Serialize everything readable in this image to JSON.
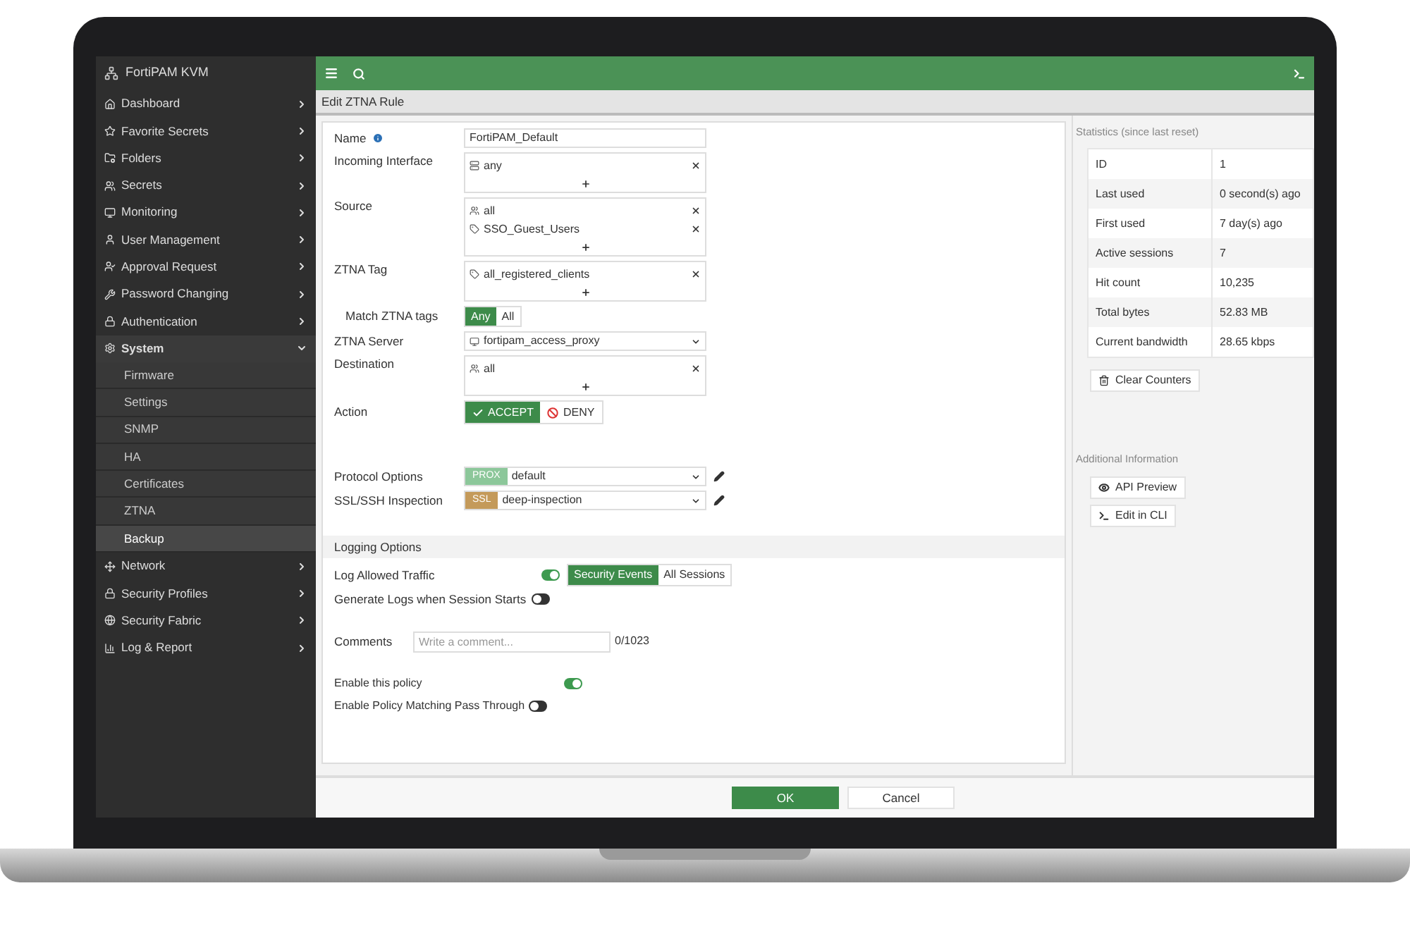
{
  "sidebar": {
    "title": "FortiPAM KVM",
    "items": [
      {
        "label": "Dashboard",
        "expanded": false
      },
      {
        "label": "Favorite Secrets",
        "expanded": false
      },
      {
        "label": "Folders",
        "expanded": false
      },
      {
        "label": "Secrets",
        "expanded": false
      },
      {
        "label": "Monitoring",
        "expanded": false
      },
      {
        "label": "User Management",
        "expanded": false
      },
      {
        "label": "Approval Request",
        "expanded": false
      },
      {
        "label": "Password Changing",
        "expanded": false
      },
      {
        "label": "Authentication",
        "expanded": false
      },
      {
        "label": "System",
        "expanded": true,
        "children": [
          {
            "label": "Firmware",
            "selected": false
          },
          {
            "label": "Settings",
            "selected": false
          },
          {
            "label": "SNMP",
            "selected": false
          },
          {
            "label": "HA",
            "selected": false
          },
          {
            "label": "Certificates",
            "selected": false
          },
          {
            "label": "ZTNA",
            "selected": false
          },
          {
            "label": "Backup",
            "selected": true
          }
        ]
      },
      {
        "label": "Network",
        "expanded": false
      },
      {
        "label": "Security Profiles",
        "expanded": false
      },
      {
        "label": "Security Fabric",
        "expanded": false
      },
      {
        "label": "Log & Report",
        "expanded": false
      }
    ]
  },
  "header": {
    "title": "Edit ZTNA Rule"
  },
  "form": {
    "policy": [
      {
        "kind": "text",
        "label": "Name",
        "value": "FortiPAM_Default"
      },
      {
        "kind": "multi",
        "label": "Incoming Interface",
        "entries": [
          "any"
        ]
      },
      {
        "kind": "multi",
        "label": "Source",
        "entries": [
          "all",
          "SSO_Guest_Users"
        ]
      },
      {
        "kind": "multi",
        "label": "ZTNA Tag",
        "entries": [
          "all_registered_clients"
        ]
      },
      {
        "kind": "segmented",
        "label": "Match ZTNA tags",
        "options": [
          {
            "label": "Any",
            "selected": true
          },
          {
            "label": "All",
            "selected": false
          }
        ]
      },
      {
        "kind": "select",
        "label": "ZTNA Server",
        "value": "fortipam_access_proxy"
      },
      {
        "kind": "multi",
        "label": "Destination",
        "entries": [
          "all"
        ]
      },
      {
        "kind": "action",
        "label": "Action",
        "options": [
          {
            "label": "ACCEPT",
            "selected": true
          },
          {
            "label": "DENY",
            "selected": false
          }
        ]
      }
    ],
    "inspection": [
      {
        "label": "Protocol Options",
        "badge": "PROX",
        "color": "#8cc79a",
        "value": "default"
      },
      {
        "label": "SSL/SSH Inspection",
        "badge": "SSL",
        "color": "#c49a5a",
        "value": "deep-inspection"
      }
    ],
    "logging": {
      "title": "Logging Options",
      "fields": [
        {
          "kind": "toggle_segmented",
          "label": "Log Allowed Traffic",
          "on": true,
          "options": [
            {
              "label": "Security Events",
              "selected": true
            },
            {
              "label": "All Sessions",
              "selected": false
            }
          ]
        },
        {
          "kind": "toggle",
          "label": "Generate Logs when Session Starts",
          "on": false
        }
      ]
    },
    "comments": {
      "label": "Comments",
      "placeholder": "Write a comment...",
      "counter": "0/1023"
    },
    "toggles": [
      {
        "label": "Enable this policy",
        "on": true
      },
      {
        "label": "Enable Policy Matching Pass Through",
        "on": false
      }
    ]
  },
  "statistics": {
    "title": "Statistics (since last reset)",
    "rows": [
      {
        "label": "ID",
        "value": "1"
      },
      {
        "label": "Last used",
        "value": "0 second(s) ago"
      },
      {
        "label": "First used",
        "value": "7 day(s) ago"
      },
      {
        "label": "Active sessions",
        "value": "7"
      },
      {
        "label": "Hit count",
        "value": "10,235"
      },
      {
        "label": "Total bytes",
        "value": "52.83 MB"
      },
      {
        "label": "Current bandwidth",
        "value": "28.65 kbps"
      }
    ],
    "button": "Clear Counters"
  },
  "additional": {
    "title": "Additional Information",
    "buttons": [
      "API Preview",
      "Edit in CLI"
    ]
  },
  "footer": {
    "buttons": [
      {
        "label": "OK",
        "kind": "primary"
      },
      {
        "label": "Cancel",
        "kind": "secondary"
      }
    ]
  }
}
